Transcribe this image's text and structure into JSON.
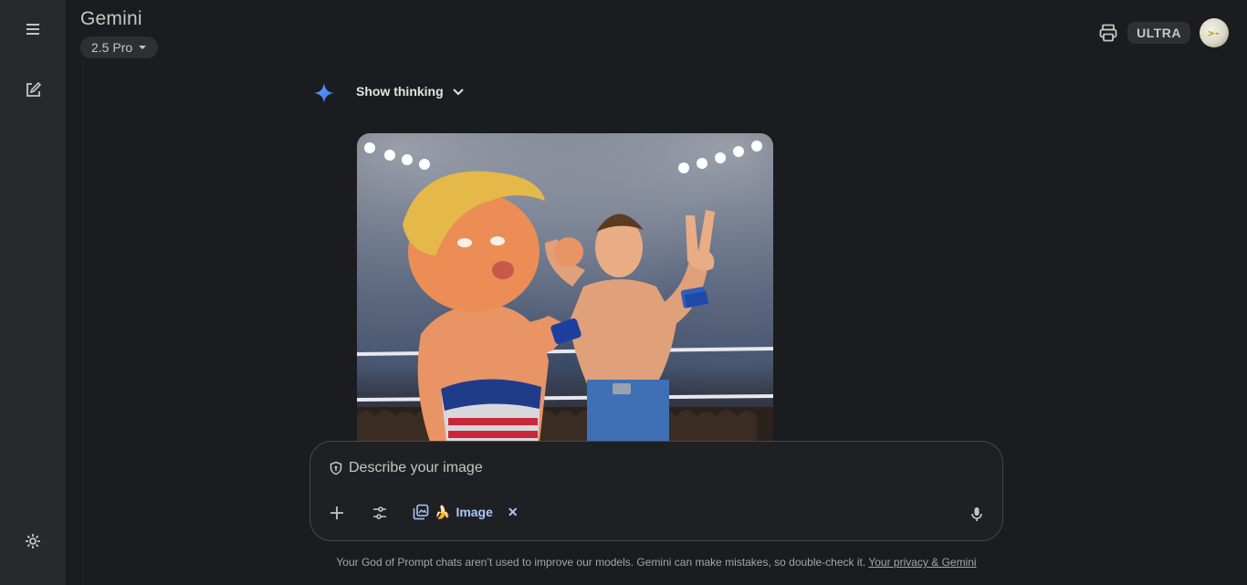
{
  "app": {
    "title": "Gemini",
    "model_label": "2.5 Pro",
    "plan_badge": "ULTRA"
  },
  "rail": {
    "menu_icon": "hamburger-menu-icon",
    "new_chat_icon": "edit-square-icon",
    "settings_icon": "gear-icon"
  },
  "response": {
    "thinking_label": "Show thinking",
    "spark_icon": "gemini-spark-icon"
  },
  "composer": {
    "placeholder": "Describe your image",
    "tool_chip_label": "Image",
    "tool_chip_emoji": "🍌"
  },
  "footer": {
    "disclaimer": "Your God of Prompt chats aren’t used to improve our models. Gemini can make mistakes, so double-check it.",
    "privacy_link": "Your privacy & Gemini"
  },
  "colors": {
    "background": "#1b1c1f",
    "rail": "#28292c",
    "accent_blue": "#a8c7fa",
    "spark_blue": "#4f8df5"
  }
}
